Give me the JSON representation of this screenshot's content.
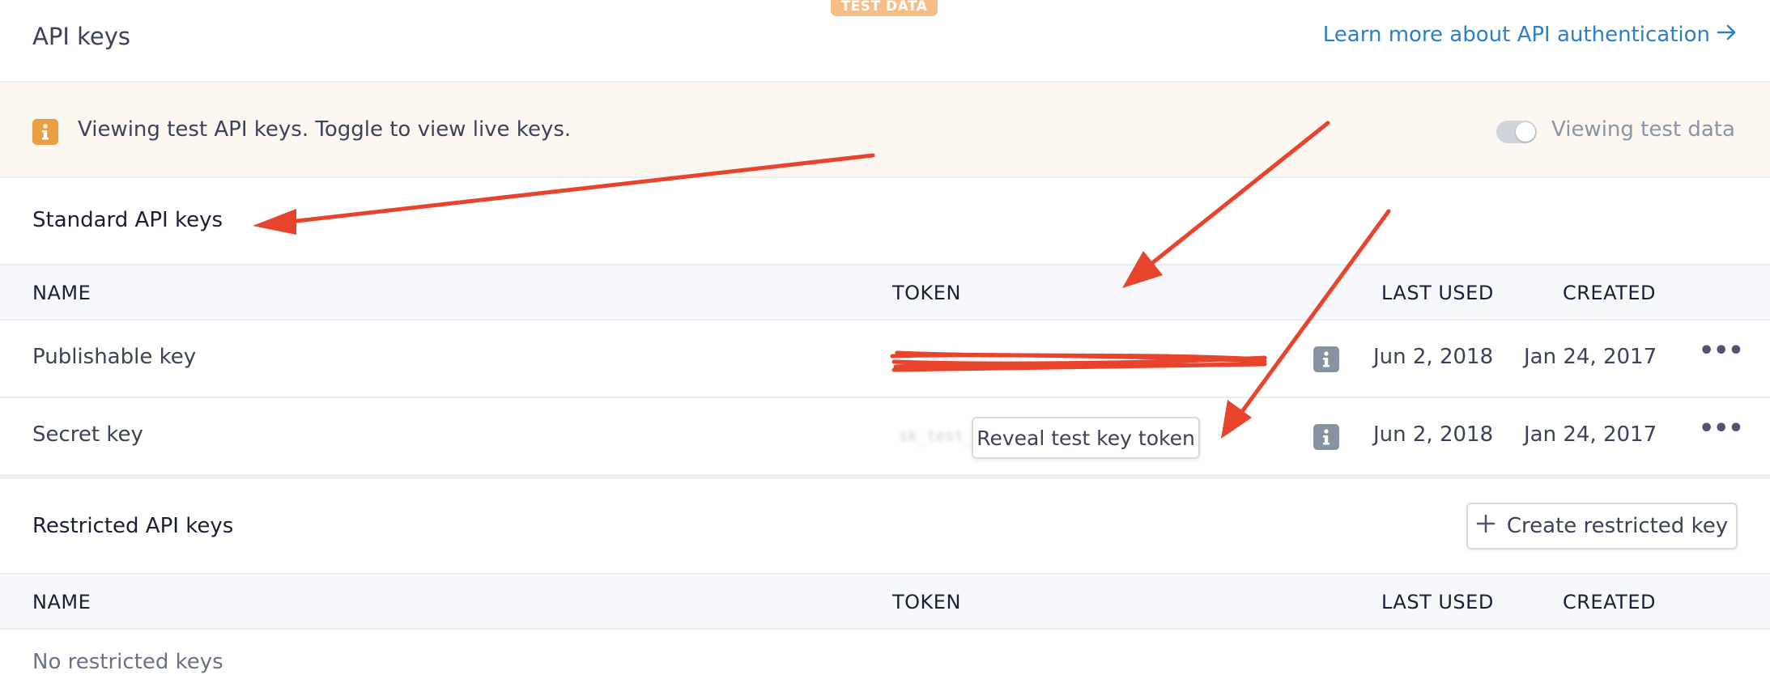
{
  "header": {
    "badge": "TEST DATA",
    "title": "API keys",
    "learn_link": "Learn more about API authentication"
  },
  "banner": {
    "icon": "info-icon",
    "message": "Viewing test API keys. Toggle to view live keys.",
    "toggle_label": "Viewing test data",
    "toggle_on": false
  },
  "standard": {
    "title": "Standard API keys",
    "columns": [
      "NAME",
      "TOKEN",
      "LAST USED",
      "CREATED"
    ],
    "rows": [
      {
        "name": "Publishable key",
        "token": "pk_test_••••••••••••••••••••••",
        "last_used": "Jun 2, 2018",
        "created": "Jan 24, 2017"
      },
      {
        "name": "Secret key",
        "token": "sk_test_••••••••••••••••••••••",
        "last_used": "Jun 2, 2018",
        "created": "Jan 24, 2017"
      }
    ],
    "tooltip": "Reveal test key token"
  },
  "restricted": {
    "title": "Restricted API keys",
    "create_button": "Create restricted key",
    "columns": [
      "NAME",
      "TOKEN",
      "LAST USED",
      "CREATED"
    ],
    "empty_text": "No restricted keys"
  },
  "colors": {
    "link": "#2e7fc7",
    "badge": "#f5be86",
    "info_orange": "#e9a044",
    "info_gray": "#8792a2",
    "annotation_red": "#e8432c",
    "banner_bg": "#fdf7f2"
  }
}
